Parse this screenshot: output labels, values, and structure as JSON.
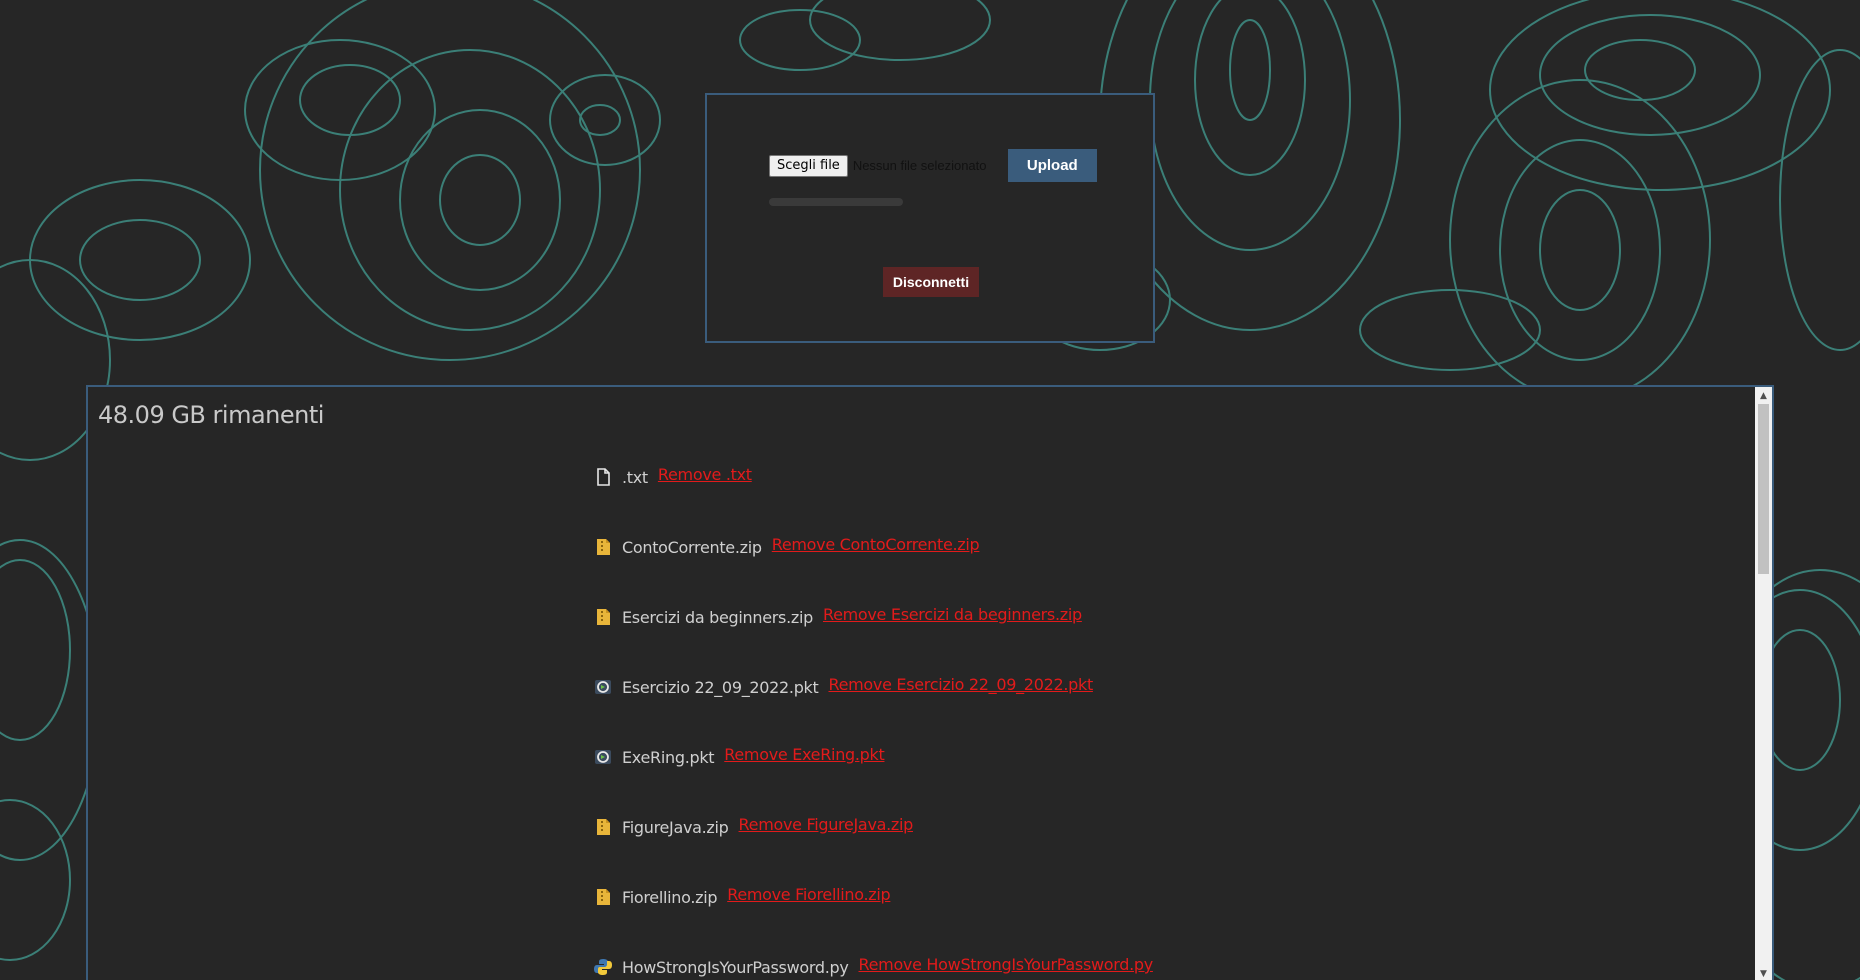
{
  "upload": {
    "choose_file_label": "Scegli file",
    "no_file_text": "Nessun file selezionato",
    "upload_label": "Upload",
    "progress": 0,
    "disconnect_label": "Disconnetti"
  },
  "files": {
    "storage_remaining": "48.09 GB rimanenti",
    "items": [
      {
        "name": ".txt",
        "remove_label": "Remove .txt",
        "icon": "text-file-icon"
      },
      {
        "name": "ContoCorrente.zip",
        "remove_label": "Remove ContoCorrente.zip",
        "icon": "zip-file-icon"
      },
      {
        "name": "Esercizi da beginners.zip",
        "remove_label": "Remove Esercizi da beginners.zip",
        "icon": "zip-file-icon"
      },
      {
        "name": "Esercizio 22_09_2022.pkt",
        "remove_label": "Remove Esercizio 22_09_2022.pkt",
        "icon": "packet-tracer-file-icon"
      },
      {
        "name": "ExeRing.pkt",
        "remove_label": "Remove ExeRing.pkt",
        "icon": "packet-tracer-file-icon"
      },
      {
        "name": "FigureJava.zip",
        "remove_label": "Remove FigureJava.zip",
        "icon": "zip-file-icon"
      },
      {
        "name": "Fiorellino.zip",
        "remove_label": "Remove Fiorellino.zip",
        "icon": "zip-file-icon"
      },
      {
        "name": "HowStrongIsYourPassword.py",
        "remove_label": "Remove HowStrongIsYourPassword.py",
        "icon": "python-file-icon"
      }
    ]
  },
  "colors": {
    "background": "#262626",
    "contour": "#3f8f86",
    "panel_border": "#3a5c7c",
    "upload_button": "#3a5c7c",
    "disconnect_button": "#5e2525",
    "remove_link": "#e21b1b"
  }
}
